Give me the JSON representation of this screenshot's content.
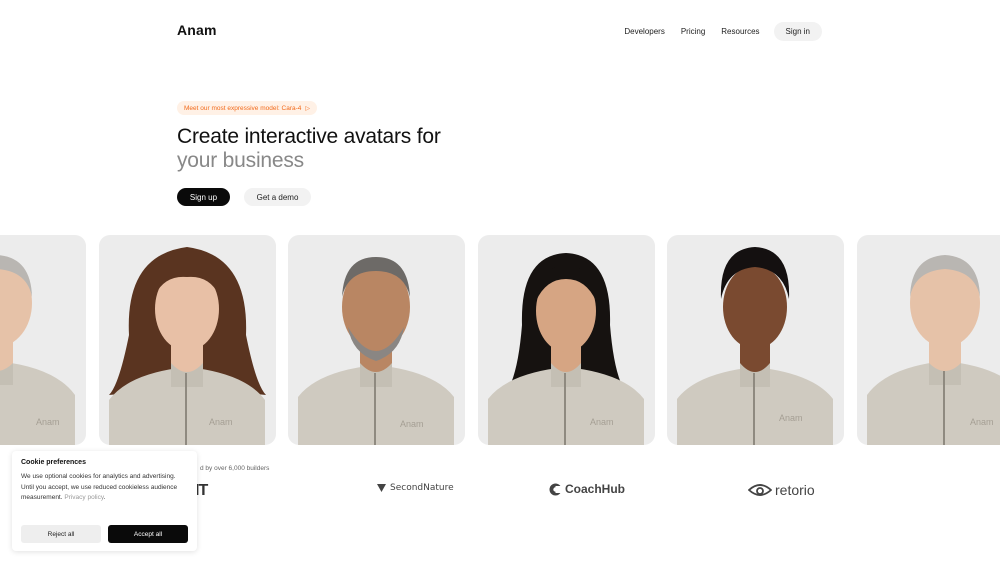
{
  "header": {
    "logo": "Anam",
    "nav": [
      "Developers",
      "Pricing",
      "Resources"
    ],
    "signin": "Sign in"
  },
  "hero": {
    "pill": "Meet our most expressive model: Cara-4",
    "pill_arrow": "▷",
    "title_line1": "Create interactive avatars for",
    "title_line2": "your business",
    "signup": "Sign up",
    "demo": "Get a demo"
  },
  "avatars": {
    "sweater_logo": "Anam",
    "items": [
      {
        "name": "older-man-cropped",
        "skin": "#e6c2a8",
        "hair": "#b9b6b2"
      },
      {
        "name": "woman-curly-hair",
        "skin": "#e8c0a6",
        "hair": "#5a3420"
      },
      {
        "name": "man-gray-beard",
        "skin": "#b98663",
        "hair": "#6d6a67"
      },
      {
        "name": "woman-dark-hair",
        "skin": "#d6a583",
        "hair": "#161210"
      },
      {
        "name": "woman-short-hair",
        "skin": "#7a4a30",
        "hair": "#141010"
      },
      {
        "name": "older-man",
        "skin": "#e6c2a8",
        "hair": "#b9b6b2"
      }
    ]
  },
  "trusted": {
    "text": "d by over 6,000 builders",
    "logos": [
      "IT",
      "SecondNature",
      "CoachHub",
      "retorio"
    ]
  },
  "cookie": {
    "title": "Cookie preferences",
    "text": "We use optional cookies for analytics and advertising. Until you accept, we use reduced cookieless audience measurement.",
    "link": "Privacy policy",
    "reject": "Reject all",
    "accept": "Accept all"
  },
  "colors": {
    "accent_orange": "#f26a1b",
    "pill_bg": "#fff1e6",
    "primary_button": "#0a0a0a",
    "muted_title": "#888888",
    "card_bg": "#ececec",
    "sweater": "#cfcac0"
  }
}
